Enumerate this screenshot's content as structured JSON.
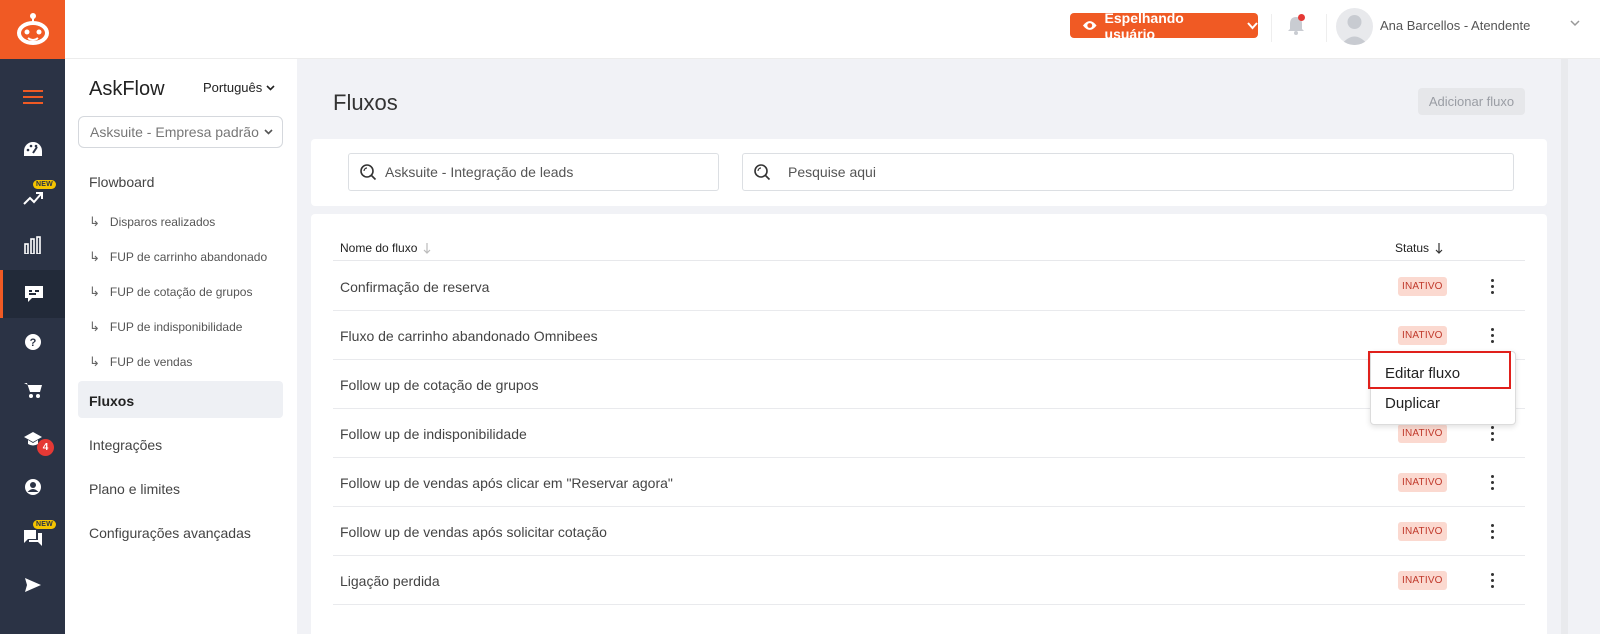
{
  "app": {
    "brand": "AskFlow",
    "language": "Português",
    "company": "Asksuite - Empresa padrão"
  },
  "topbar": {
    "mirror_label": "Espelhando usuário",
    "user_name": "Ana Barcellos - Atendente",
    "icons": [
      "eye-icon",
      "chevron-down-icon",
      "bell-icon",
      "avatar"
    ]
  },
  "rail": {
    "new_badge": "NEW",
    "education_count": "4",
    "icons": [
      "robot-logo",
      "menu-icon",
      "dashboard-icon",
      "trending-icon",
      "bar-chart-icon",
      "chat-flow-icon",
      "help-icon",
      "cart-icon",
      "school-icon",
      "account-icon",
      "chat-icon",
      "send-icon"
    ]
  },
  "sidebar": {
    "section": "Flowboard",
    "sub_items": [
      "Disparos realizados",
      "FUP de carrinho abandonado",
      "FUP de cotação de grupos",
      "FUP de indisponibilidade",
      "FUP de vendas"
    ],
    "items": [
      "Fluxos",
      "Integrações",
      "Plano e limites",
      "Configurações avançadas"
    ],
    "active": "Fluxos"
  },
  "main": {
    "title": "Fluxos",
    "add_button": "Adicionar fluxo",
    "filter_value": "Asksuite - Integração de leads",
    "search_placeholder": "Pesquise aqui",
    "col_name": "Nome do fluxo",
    "col_status": "Status",
    "rows": [
      {
        "name": "Confirmação de reserva",
        "status": "INATIVO"
      },
      {
        "name": "Fluxo de carrinho abandonado Omnibees",
        "status": "INATIVO"
      },
      {
        "name": "Follow up de cotação de grupos",
        "status": ""
      },
      {
        "name": "Follow up de indisponibilidade",
        "status": "INATIVO"
      },
      {
        "name": "Follow up de vendas após clicar em \"Reservar agora\"",
        "status": "INATIVO"
      },
      {
        "name": "Follow up de vendas após solicitar cotação",
        "status": "INATIVO"
      },
      {
        "name": "Ligação perdida",
        "status": "INATIVO"
      }
    ]
  },
  "menu": {
    "items": [
      "Editar fluxo",
      "Duplicar"
    ],
    "highlighted": "Editar fluxo",
    "highlight_color": "#e0201b"
  },
  "colors": {
    "accent": "#f05a24",
    "rail": "#2b3345",
    "status_bg": "#fbd9d0",
    "status_text": "#c0392b"
  }
}
